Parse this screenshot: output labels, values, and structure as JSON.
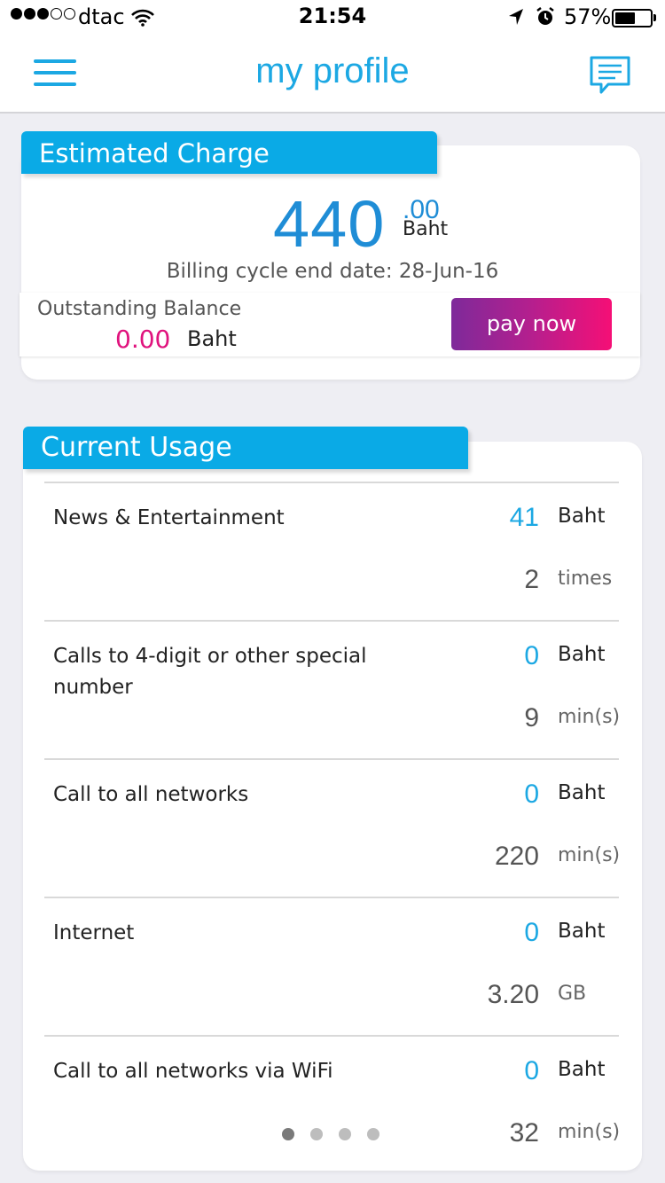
{
  "status_bar": {
    "carrier": "dtac",
    "time": "21:54",
    "battery_percent": "57%",
    "battery_level": 0.57,
    "signal_bars_filled": 3,
    "signal_bars_total": 5
  },
  "nav": {
    "title": "my profile",
    "left_icon": "hamburger-menu-icon",
    "right_icon": "chat-message-icon",
    "accent_color": "#1ca8e3"
  },
  "estimated_charge": {
    "tab_label": "Estimated Charge",
    "amount": "440",
    "decimals": ".00",
    "unit": "Baht",
    "cycle_text": "Billing cycle end date: 28-Jun-16",
    "outstanding_label": "Outstanding Balance",
    "outstanding_value": "0.00",
    "outstanding_unit": "Baht",
    "pay_label": "pay now"
  },
  "current_usage": {
    "tab_label": "Current Usage",
    "rows": [
      {
        "name": "News & Entertainment",
        "value1": "41",
        "unit1": "Baht",
        "value2": "2",
        "unit2": "times"
      },
      {
        "name": "Calls to 4-digit or other special number",
        "value1": "0",
        "unit1": "Baht",
        "value2": "9",
        "unit2": "min(s)"
      },
      {
        "name": "Call to all networks",
        "value1": "0",
        "unit1": "Baht",
        "value2": "220",
        "unit2": "min(s)"
      },
      {
        "name": "Internet",
        "value1": "0",
        "unit1": "Baht",
        "value2": "3.20",
        "unit2": "GB"
      },
      {
        "name": "Call to all networks via WiFi",
        "value1": "0",
        "unit1": "Baht",
        "value2": "32",
        "unit2": "min(s)"
      }
    ],
    "pager_total": 4,
    "pager_active": 1
  }
}
